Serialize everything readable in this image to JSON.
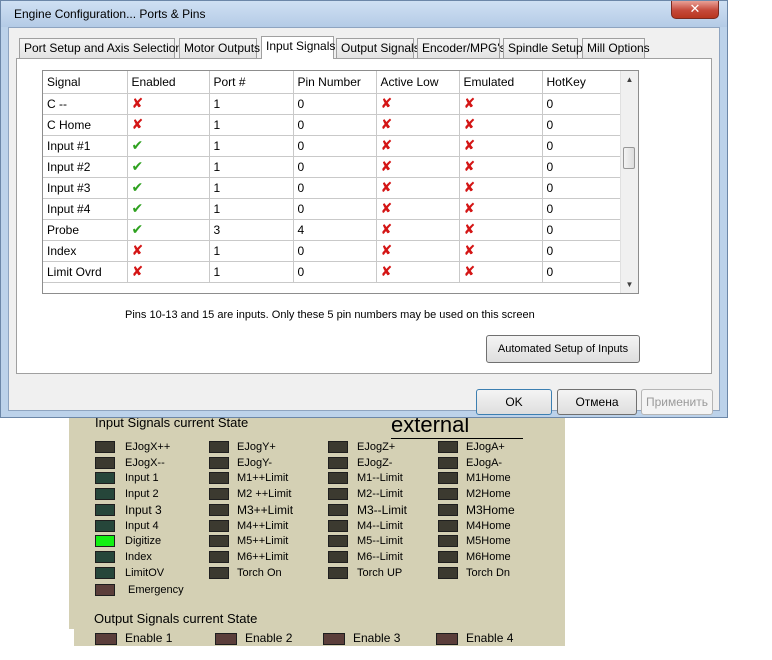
{
  "window": {
    "title": "Engine Configuration... Ports & Pins",
    "close_glyph": "✕"
  },
  "tabs": [
    {
      "label": "Port Setup and Axis Selection",
      "active": false
    },
    {
      "label": "Motor Outputs",
      "active": false
    },
    {
      "label": "Input Signals",
      "active": true
    },
    {
      "label": "Output Signals",
      "active": false
    },
    {
      "label": "Encoder/MPG's",
      "active": false
    },
    {
      "label": "Spindle Setup",
      "active": false
    },
    {
      "label": "Mill Options",
      "active": false
    }
  ],
  "table": {
    "columns": [
      "Signal",
      "Enabled",
      "Port #",
      "Pin Number",
      "Active Low",
      "Emulated",
      "HotKey"
    ],
    "rows": [
      {
        "signal": "C --",
        "enabled": false,
        "port": "1",
        "pin": "0",
        "active_low": false,
        "emulated": false,
        "hotkey": "0"
      },
      {
        "signal": "C Home",
        "enabled": false,
        "port": "1",
        "pin": "0",
        "active_low": false,
        "emulated": false,
        "hotkey": "0"
      },
      {
        "signal": "Input #1",
        "enabled": true,
        "port": "1",
        "pin": "0",
        "active_low": false,
        "emulated": false,
        "hotkey": "0"
      },
      {
        "signal": "Input #2",
        "enabled": true,
        "port": "1",
        "pin": "0",
        "active_low": false,
        "emulated": false,
        "hotkey": "0"
      },
      {
        "signal": "Input #3",
        "enabled": true,
        "port": "1",
        "pin": "0",
        "active_low": false,
        "emulated": false,
        "hotkey": "0"
      },
      {
        "signal": "Input #4",
        "enabled": true,
        "port": "1",
        "pin": "0",
        "active_low": false,
        "emulated": false,
        "hotkey": "0"
      },
      {
        "signal": "Probe",
        "enabled": true,
        "port": "3",
        "pin": "4",
        "active_low": false,
        "emulated": false,
        "hotkey": "0"
      },
      {
        "signal": "Index",
        "enabled": false,
        "port": "1",
        "pin": "0",
        "active_low": false,
        "emulated": false,
        "hotkey": "0"
      },
      {
        "signal": "Limit Ovrd",
        "enabled": false,
        "port": "1",
        "pin": "0",
        "active_low": false,
        "emulated": false,
        "hotkey": "0"
      }
    ],
    "scroll_up_glyph": "▲",
    "scroll_down_glyph": "▼"
  },
  "note": "Pins 10-13 and 15 are inputs. Only these 5 pin numbers may be used on this screen",
  "buttons": {
    "automated": "Automated Setup of Inputs",
    "ok": "OK",
    "cancel": "Отмена",
    "apply": "Применить"
  },
  "diagnostics": {
    "input_header": "Input Signals current State",
    "external_label": "external",
    "columns": [
      [
        {
          "label": "EJogX++",
          "color": "#3c3a30"
        },
        {
          "label": "EJogX--",
          "color": "#3c3a30"
        },
        {
          "label": "Input 1",
          "color": "#26463a"
        },
        {
          "label": "Input 2",
          "color": "#26463a"
        },
        {
          "label": "Input 3",
          "color": "#26463a"
        },
        {
          "label": "Input 4",
          "color": "#26463a"
        },
        {
          "label": "Digitize",
          "color": "#12f012"
        },
        {
          "label": "Index",
          "color": "#26463a"
        },
        {
          "label": "LimitOV",
          "color": "#26463a"
        },
        {
          "label": "Emergency",
          "color": "#5b3e3a"
        }
      ],
      [
        {
          "label": "EJogY+",
          "color": "#3c3a30"
        },
        {
          "label": "EJogY-",
          "color": "#3c3a30"
        },
        {
          "label": "M1++Limit",
          "color": "#3c3a30"
        },
        {
          "label": "M2 ++Limit",
          "color": "#3c3a30"
        },
        {
          "label": "M3++Limit",
          "color": "#3c3a30"
        },
        {
          "label": "M4++Limit",
          "color": "#3c3a30"
        },
        {
          "label": "M5++Limit",
          "color": "#3c3a30"
        },
        {
          "label": "M6++Limit",
          "color": "#3c3a30"
        },
        {
          "label": "Torch On",
          "color": "#3c3a30"
        }
      ],
      [
        {
          "label": "EJogZ+",
          "color": "#3c3a30"
        },
        {
          "label": "EJogZ-",
          "color": "#3c3a30"
        },
        {
          "label": "M1--Limit",
          "color": "#3c3a30"
        },
        {
          "label": "M2--Limit",
          "color": "#3c3a30"
        },
        {
          "label": "M3--Limit",
          "color": "#3c3a30"
        },
        {
          "label": "M4--Limit",
          "color": "#3c3a30"
        },
        {
          "label": "M5--Limit",
          "color": "#3c3a30"
        },
        {
          "label": "M6--Limit",
          "color": "#3c3a30"
        },
        {
          "label": "Torch UP",
          "color": "#3c3a30"
        }
      ],
      [
        {
          "label": "EJogA+",
          "color": "#3c3a30"
        },
        {
          "label": "EJogA-",
          "color": "#3c3a30"
        },
        {
          "label": "M1Home",
          "color": "#3c3a30"
        },
        {
          "label": "M2Home",
          "color": "#3c3a30"
        },
        {
          "label": "M3Home",
          "color": "#3c3a30"
        },
        {
          "label": "M4Home",
          "color": "#3c3a30"
        },
        {
          "label": "M5Home",
          "color": "#3c3a30"
        },
        {
          "label": "M6Home",
          "color": "#3c3a30"
        },
        {
          "label": "Torch Dn",
          "color": "#3c3a30"
        }
      ]
    ],
    "output_header": "Output Signals current State",
    "outputs": [
      {
        "label": "Enable 1",
        "color": "#5b3e3a"
      },
      {
        "label": "Enable 2",
        "color": "#5b3e3a"
      },
      {
        "label": "Enable 3",
        "color": "#5b3e3a"
      },
      {
        "label": "Enable 4",
        "color": "#5b3e3a"
      }
    ]
  },
  "colors": {
    "check_on": "#2ea11f",
    "check_off": "#d41515",
    "led_active": "#12f012",
    "panel_bg": "#d4d0b4"
  }
}
